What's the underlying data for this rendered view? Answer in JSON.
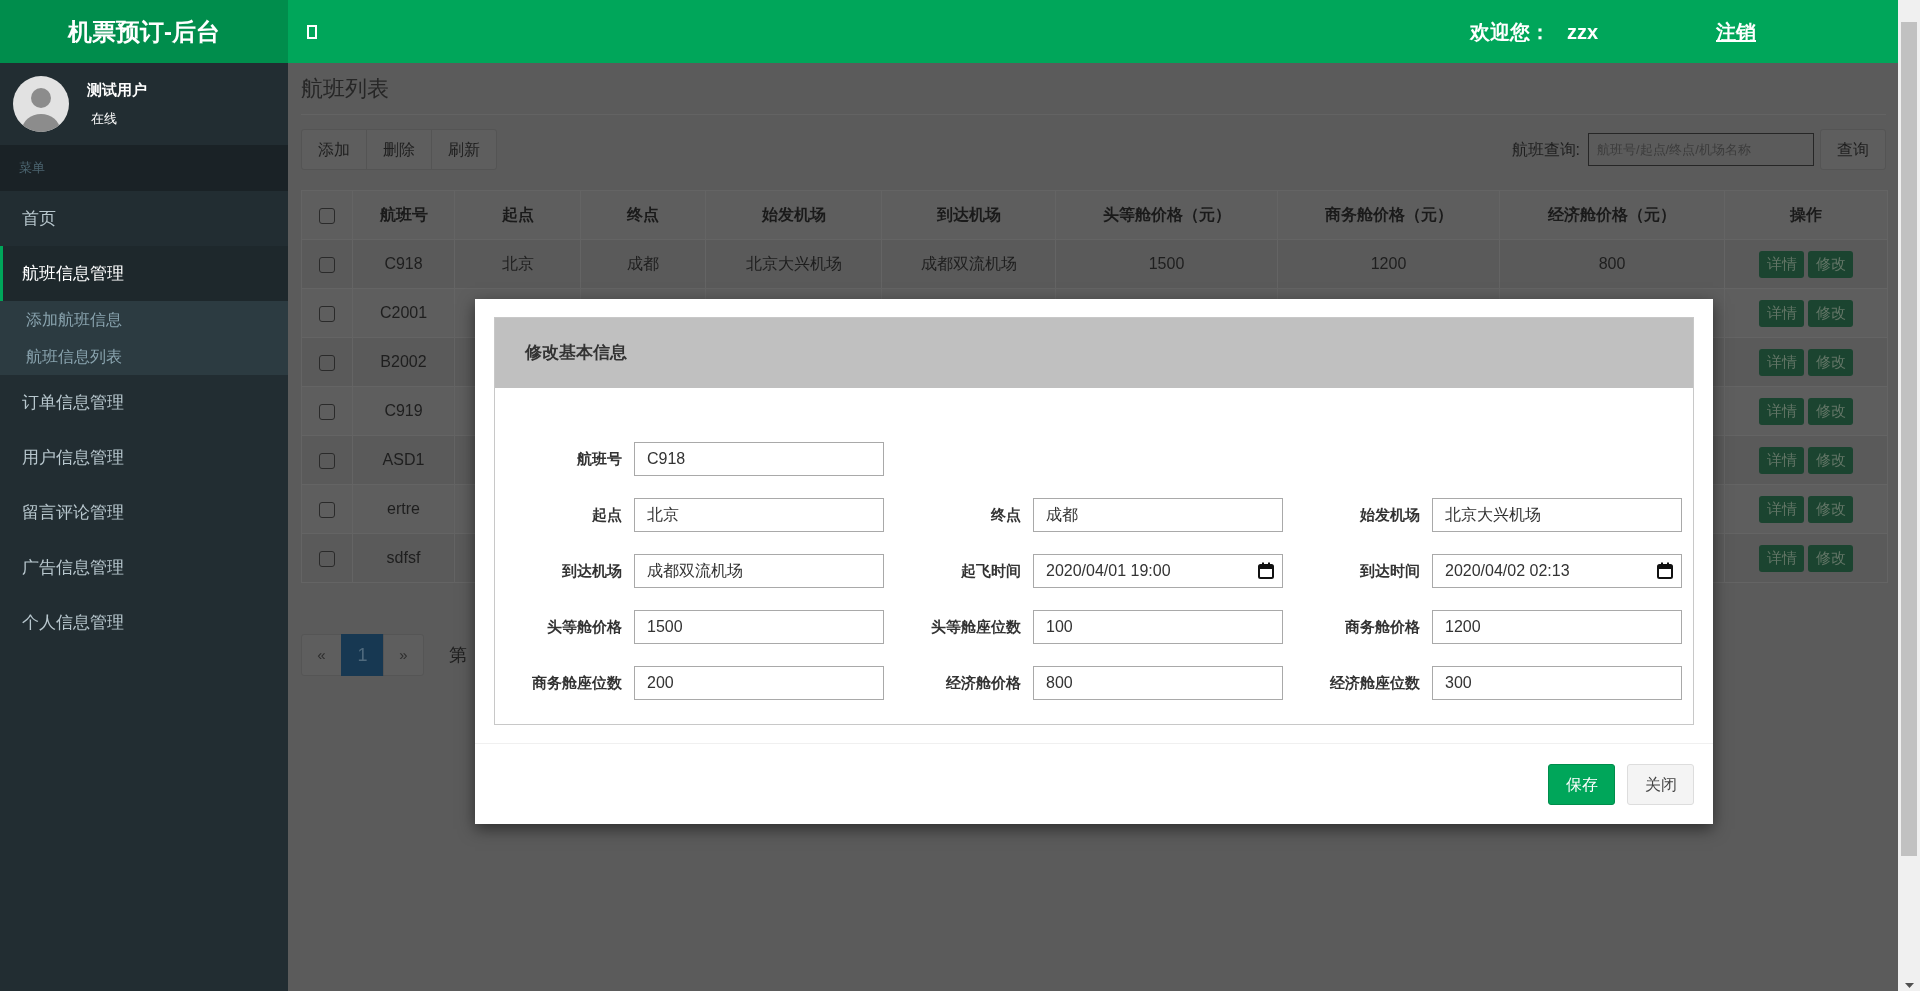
{
  "header": {
    "logo": "机票预订-后台",
    "welcome": "欢迎您：",
    "username": "zzx",
    "logout": "注销"
  },
  "sidebar": {
    "user": {
      "name": "测试用户",
      "status": "在线"
    },
    "menu_header": "菜单",
    "items": [
      {
        "label": "首页",
        "selected": false
      },
      {
        "label": "航班信息管理",
        "selected": true,
        "expanded": true,
        "children": [
          {
            "label": "添加航班信息",
            "selected": false
          },
          {
            "label": "航班信息列表",
            "selected": false
          }
        ]
      },
      {
        "label": "订单信息管理",
        "selected": false
      },
      {
        "label": "用户信息管理",
        "selected": false
      },
      {
        "label": "留言评论管理",
        "selected": false
      },
      {
        "label": "广告信息管理",
        "selected": false
      },
      {
        "label": "个人信息管理",
        "selected": false
      }
    ]
  },
  "content": {
    "title": "航班列表",
    "toolbar": [
      "添加",
      "删除",
      "刷新"
    ],
    "search": {
      "label": "航班查询:",
      "placeholder": "航班号/起点/终点/机场名称",
      "button": "查询"
    },
    "table": {
      "select_all": {
        "checked": false
      },
      "columns": [
        "航班号",
        "起点",
        "终点",
        "始发机场",
        "到达机场",
        "头等舱价格（元）",
        "商务舱价格（元）",
        "经济舱价格（元）",
        "操作"
      ],
      "rows": [
        {
          "checked": false,
          "cells": [
            "C918",
            "北京",
            "成都",
            "北京大兴机场",
            "成都双流机场",
            "1500",
            "1200",
            "800"
          ],
          "actions": [
            "详情",
            "修改"
          ]
        },
        {
          "checked": false,
          "cells": [
            "C2001"
          ],
          "actions": [
            "详情",
            "修改"
          ]
        },
        {
          "checked": false,
          "cells": [
            "B2002"
          ],
          "actions": [
            "详情",
            "修改"
          ]
        },
        {
          "checked": false,
          "cells": [
            "C919"
          ],
          "actions": [
            "详情",
            "修改"
          ]
        },
        {
          "checked": false,
          "cells": [
            "ASD1"
          ],
          "actions": [
            "详情",
            "修改"
          ]
        },
        {
          "checked": false,
          "cells": [
            "ertre"
          ],
          "actions": [
            "详情",
            "修改"
          ]
        },
        {
          "checked": false,
          "cells": [
            "sdfsf"
          ],
          "actions": [
            "详情",
            "修改"
          ]
        }
      ]
    },
    "pagination": {
      "prev": "«",
      "pages": [
        {
          "label": "1",
          "selected": true
        }
      ],
      "next": "»",
      "info": "第"
    }
  },
  "modal": {
    "title": "修改基本信息",
    "rows": [
      [
        {
          "kind": "text",
          "label": "航班号",
          "value": "C918"
        }
      ],
      [
        {
          "kind": "text",
          "label": "起点",
          "value": "北京"
        },
        {
          "kind": "text",
          "label": "终点",
          "value": "成都"
        },
        {
          "kind": "text",
          "label": "始发机场",
          "value": "北京大兴机场"
        }
      ],
      [
        {
          "kind": "text",
          "label": "到达机场",
          "value": "成都双流机场"
        },
        {
          "kind": "datetime",
          "label": "起飞时间",
          "value": "2020/04/01 19:00"
        },
        {
          "kind": "datetime",
          "label": "到达时间",
          "value": "2020/04/02 02:13"
        }
      ],
      [
        {
          "kind": "text",
          "label": "头等舱价格",
          "value": "1500"
        },
        {
          "kind": "text",
          "label": "头等舱座位数",
          "value": "100"
        },
        {
          "kind": "text",
          "label": "商务舱价格",
          "value": "1200"
        }
      ],
      [
        {
          "kind": "text",
          "label": "商务舱座位数",
          "value": "200"
        },
        {
          "kind": "text",
          "label": "经济舱价格",
          "value": "800"
        },
        {
          "kind": "text",
          "label": "经济舱座位数",
          "value": "300"
        }
      ]
    ],
    "buttons": [
      {
        "kind": "primary",
        "label": "保存"
      },
      {
        "kind": "default",
        "label": "关闭"
      }
    ]
  }
}
